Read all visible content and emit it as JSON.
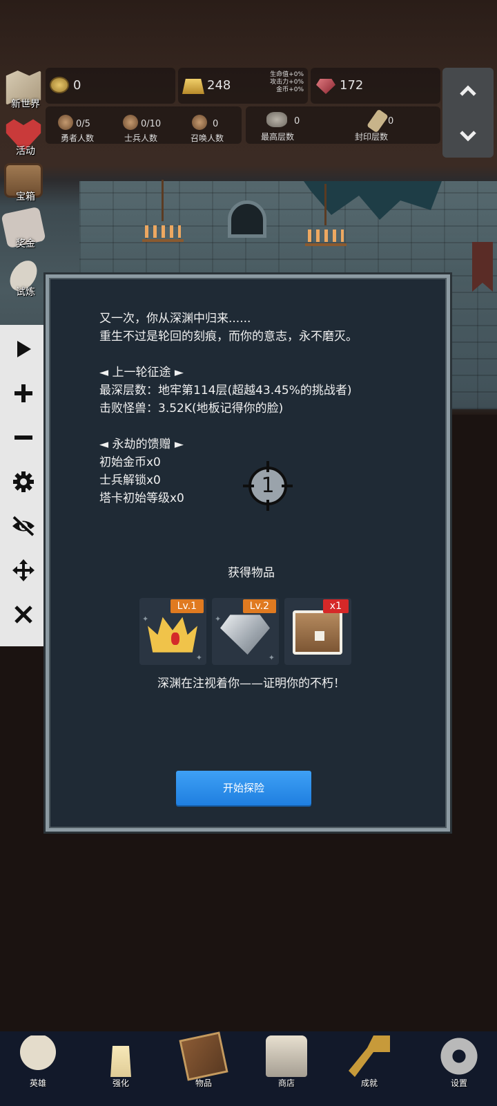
{
  "sidebar_shortcuts": [
    {
      "label": "新世界",
      "icon": "map-icon"
    },
    {
      "label": "活动",
      "icon": "heart-icon"
    },
    {
      "label": "宝箱",
      "icon": "chest-icon"
    },
    {
      "label": "奖金",
      "icon": "letter-icon"
    },
    {
      "label": "试炼",
      "icon": "feather-icon"
    }
  ],
  "resources": {
    "coins": "0",
    "gold_bars": "248",
    "bonus": {
      "hp": "生命值+0%",
      "atk": "攻击力+0%",
      "gold": "金币+0%"
    },
    "gems": "172"
  },
  "stats": {
    "heroes": {
      "value": "0/5",
      "label": "勇者人数"
    },
    "soldiers": {
      "value": "0/10",
      "label": "士兵人数"
    },
    "summons": {
      "value": "0",
      "label": "召唤人数"
    },
    "max_floor": {
      "value": "0",
      "label": "最高层数"
    },
    "seal_floor": {
      "value": "0",
      "label": "封印层数"
    }
  },
  "scroll_pad": {
    "up": "⌃",
    "down": "⌄"
  },
  "dialog": {
    "line1": "又一次，你从深渊中归来......",
    "line2": "重生不过是轮回的刻痕，而你的意志，永不磨灭。",
    "section1_title": "◄ 上一轮征途 ►",
    "deepest_floor": "最深层数：地牢第114层(超越43.45%的挑战者)",
    "monsters_defeated": "击败怪兽：3.52K(地板记得你的脸)",
    "section2_title": "◄ 永劫的馈赠 ►",
    "gift_coins": "初始金币x0",
    "gift_soldiers": "士兵解锁x0",
    "gift_tarot": "塔卡初始等级x0",
    "target_number": "1",
    "obtain_title": "获得物品",
    "items": [
      {
        "badge": "Lv.1",
        "icon": "crown-icon",
        "badge_color": "#e07a20"
      },
      {
        "badge": "Lv.2",
        "icon": "diamond-icon",
        "badge_color": "#e07a20"
      },
      {
        "badge": "x1",
        "icon": "chest-icon",
        "badge_color": "#d62828"
      }
    ],
    "abyss_message": "深渊在注视着你——证明你的不朽！",
    "start_button": "开始探险"
  },
  "bottom_nav": [
    {
      "label": "英雄",
      "icon": "skull-icon"
    },
    {
      "label": "强化",
      "icon": "candle-icon"
    },
    {
      "label": "物品",
      "icon": "book-icon"
    },
    {
      "label": "商店",
      "icon": "mug-icon"
    },
    {
      "label": "成就",
      "icon": "key-icon"
    },
    {
      "label": "设置",
      "icon": "gear-icon"
    }
  ],
  "colors": {
    "dialog_bg": "#1f2a35",
    "start_button": "#2f8ef0",
    "badge_orange": "#e07a20",
    "badge_red": "#d62828"
  }
}
